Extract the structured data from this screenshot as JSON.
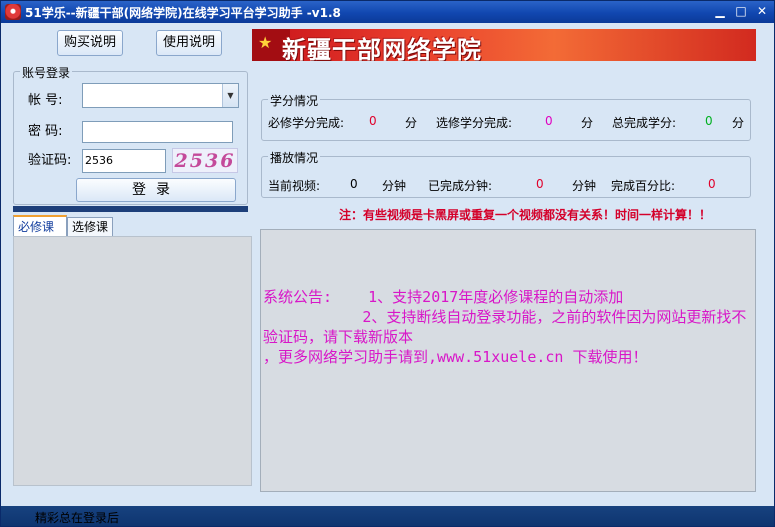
{
  "window": {
    "title": "51学乐--新疆干部(网络学院)在线学习平台学习助手 -v1.8",
    "min": "▁",
    "max": "□",
    "close": "✕"
  },
  "toolbar": {
    "buy_label": "购买说明",
    "use_label": "使用说明"
  },
  "banner": {
    "text": "新疆干部网络学院"
  },
  "login": {
    "group_title": "账号登录",
    "account_label": "帐  号:",
    "account_value": "",
    "password_label": "密  码:",
    "password_value": "",
    "captcha_label": "验证码:",
    "captcha_value": "2536",
    "captcha_image_text": "2536",
    "login_label": "登录"
  },
  "tabs": {
    "required": "必修课",
    "elective": "选修课"
  },
  "credits": {
    "group_title": "学分情况",
    "required_label": "必修学分完成:",
    "required_value": "0",
    "required_unit": "分",
    "elective_label": "选修学分完成:",
    "elective_value": "0",
    "elective_unit": "分",
    "total_label": "总完成学分:",
    "total_value": "0",
    "total_unit": "分"
  },
  "playback": {
    "group_title": "播放情况",
    "current_label": "当前视频:",
    "current_value": "0",
    "current_unit": "分钟",
    "done_label": "已完成分钟:",
    "done_value": "0",
    "done_unit": "分钟",
    "percent_label": "完成百分比:",
    "percent_value": "0"
  },
  "notice": "注：有些视频是卡黑屏或重复一个视频都没有关系！时间一样计算！！",
  "announcement": "系统公告:    1、支持2017年度必修课程的自动添加\n           2、支持断线自动登录功能，之前的软件因为网站更新找不验证码，请下载新版本\n，更多网络学习助手请到,www.51xuele.cn 下载使用！",
  "status": "精彩总在登录后",
  "colors": {
    "title_bar": "#1147b0",
    "background": "#d8e6f5",
    "announcement_text": "#d816c8",
    "notice_text": "#d4002a"
  }
}
